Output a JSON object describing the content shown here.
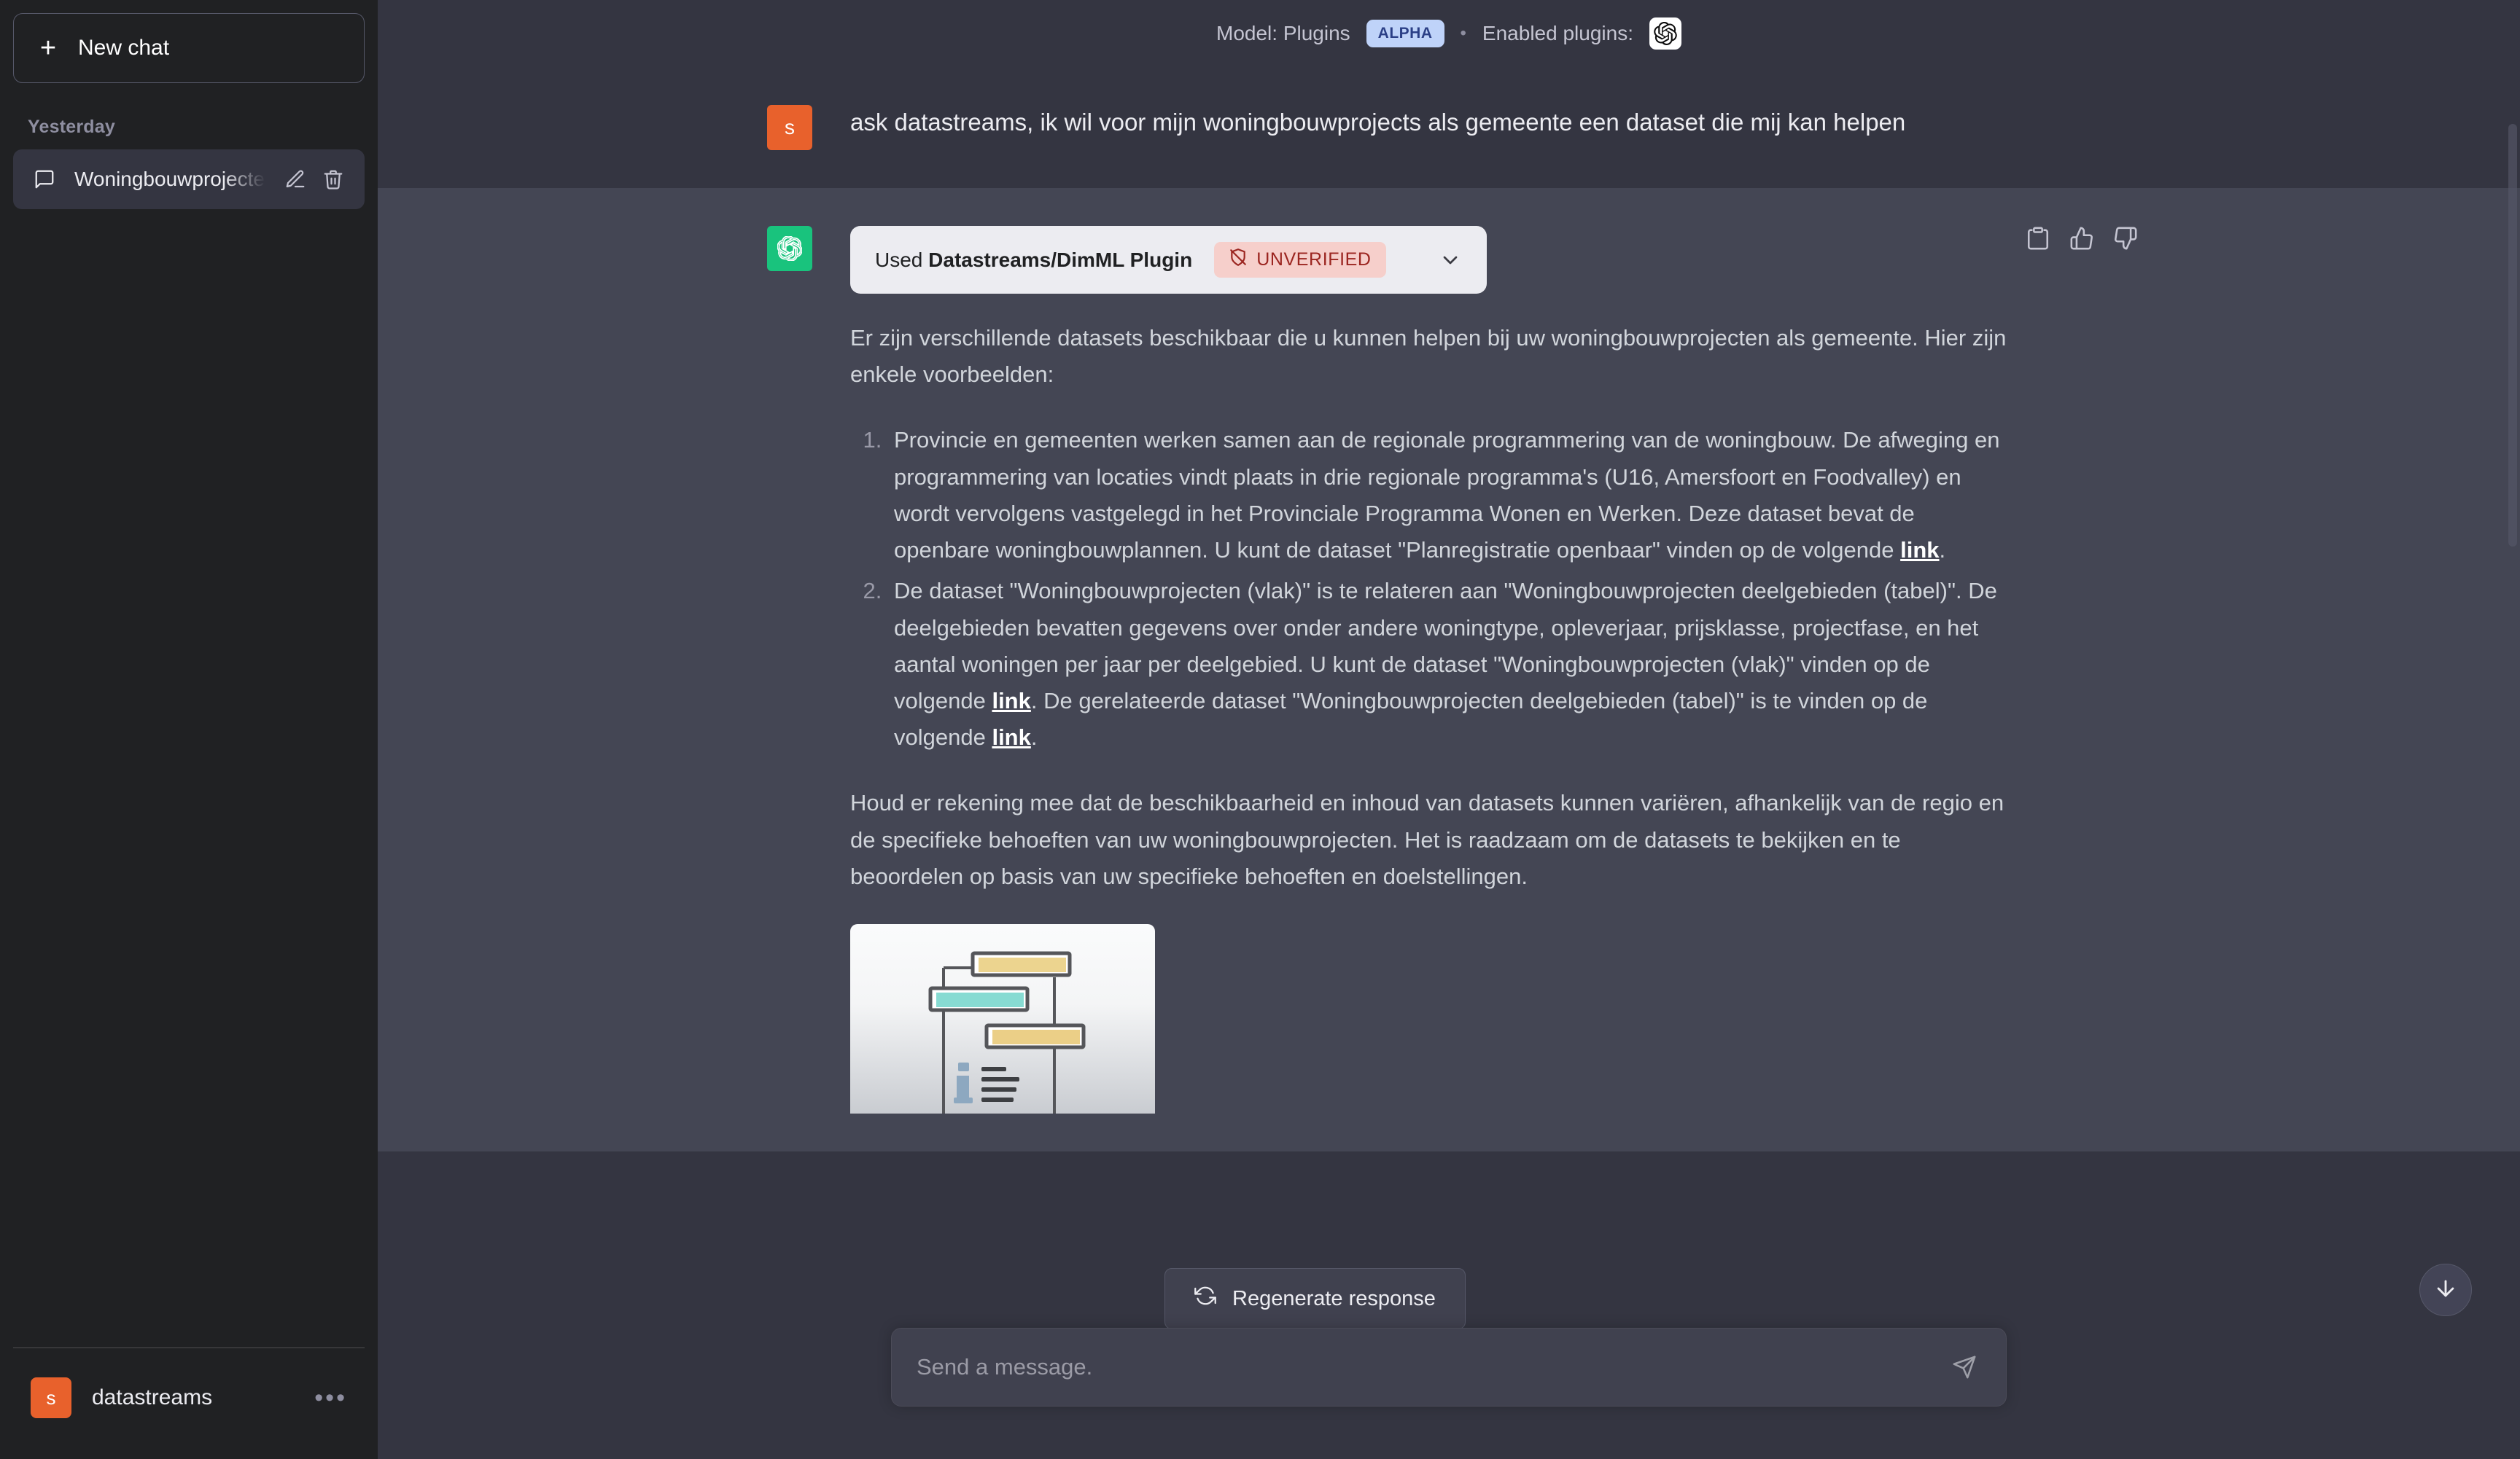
{
  "sidebar": {
    "new_chat_label": "New chat",
    "section_label": "Yesterday",
    "chat_items": [
      {
        "title": "Woningbouwprojecten Datasets"
      }
    ],
    "user": {
      "avatar_initial": "s",
      "name": "datastreams",
      "more_label": "•••"
    }
  },
  "topbar": {
    "model_label": "Model: Plugins",
    "alpha_badge": "ALPHA",
    "separator": "•",
    "enabled_plugins_label": "Enabled plugins:",
    "plugin_icon": "openai-plugin-icon"
  },
  "messages": {
    "user": {
      "avatar_initial": "s",
      "text": "ask datastreams, ik wil voor mijn woningbouwprojects als gemeente een dataset die mij kan helpen"
    },
    "assistant": {
      "plugin_card": {
        "used_prefix": "Used",
        "plugin_name": "Datastreams/DimML Plugin",
        "badge": "UNVERIFIED",
        "chevron": "chevron-down-icon"
      },
      "intro": "Er zijn verschillende datasets beschikbaar die u kunnen helpen bij uw woningbouwprojecten als gemeente. Hier zijn enkele voorbeelden:",
      "list": [
        {
          "part1": "Provincie en gemeenten werken samen aan de regionale programmering van de woningbouw. De afweging en programmering van locaties vindt plaats in drie regionale programma's (U16, Amersfoort en Foodvalley) en wordt vervolgens vastgelegd in het Provinciale Programma Wonen en Werken. Deze dataset bevat de openbare woningbouwplannen. U kunt de dataset \"Planregistratie openbaar\" vinden op de volgende ",
          "link1": "link",
          "part2": ".",
          "link2": "",
          "part3": "",
          "link3": "",
          "part4": ""
        },
        {
          "part1": "De dataset \"Woningbouwprojecten (vlak)\" is te relateren aan \"Woningbouwprojecten deelgebieden (tabel)\". De deelgebieden bevatten gegevens over onder andere woningtype, opleverjaar, prijsklasse, projectfase, en het aantal woningen per jaar per deelgebied. U kunt de dataset \"Woningbouwprojecten (vlak)\" vinden op de volgende ",
          "link1": "link",
          "part2": ". De gerelateerde dataset \"Woningbouwprojecten deelgebieden (tabel)\" is te vinden op de volgende ",
          "link2": "link",
          "part3": ".",
          "link3": "",
          "part4": ""
        }
      ],
      "outro": "Houd er rekening mee dat de beschikbaarheid en inhoud van datasets kunnen variëren, afhankelijk van de regio en de specifieke behoeften van uw woningbouwprojecten. Het is raadzaam om de datasets te bekijken en te beoordelen op basis van uw specifieke behoeften en doelstellingen.",
      "image_preview_alt": "dataset-diagram-preview",
      "actions": [
        {
          "name": "copy-icon"
        },
        {
          "name": "thumbs-up-icon"
        },
        {
          "name": "thumbs-down-icon"
        }
      ]
    }
  },
  "composer": {
    "regenerate_label": "Regenerate response",
    "regenerate_icon": "refresh-icon",
    "placeholder": "Send a message.",
    "value": "",
    "send_icon": "send-icon",
    "scroll_down_icon": "arrow-down-icon"
  },
  "colors": {
    "sidebar_bg": "#202123",
    "main_bg": "#343541",
    "assistant_bg": "#444654",
    "accent_orange": "#e8612c",
    "accent_green": "#19c37d",
    "alpha_badge_bg": "#bfd3f9",
    "unverified_bg": "#f6cfcb",
    "unverified_fg": "#9b2520"
  }
}
